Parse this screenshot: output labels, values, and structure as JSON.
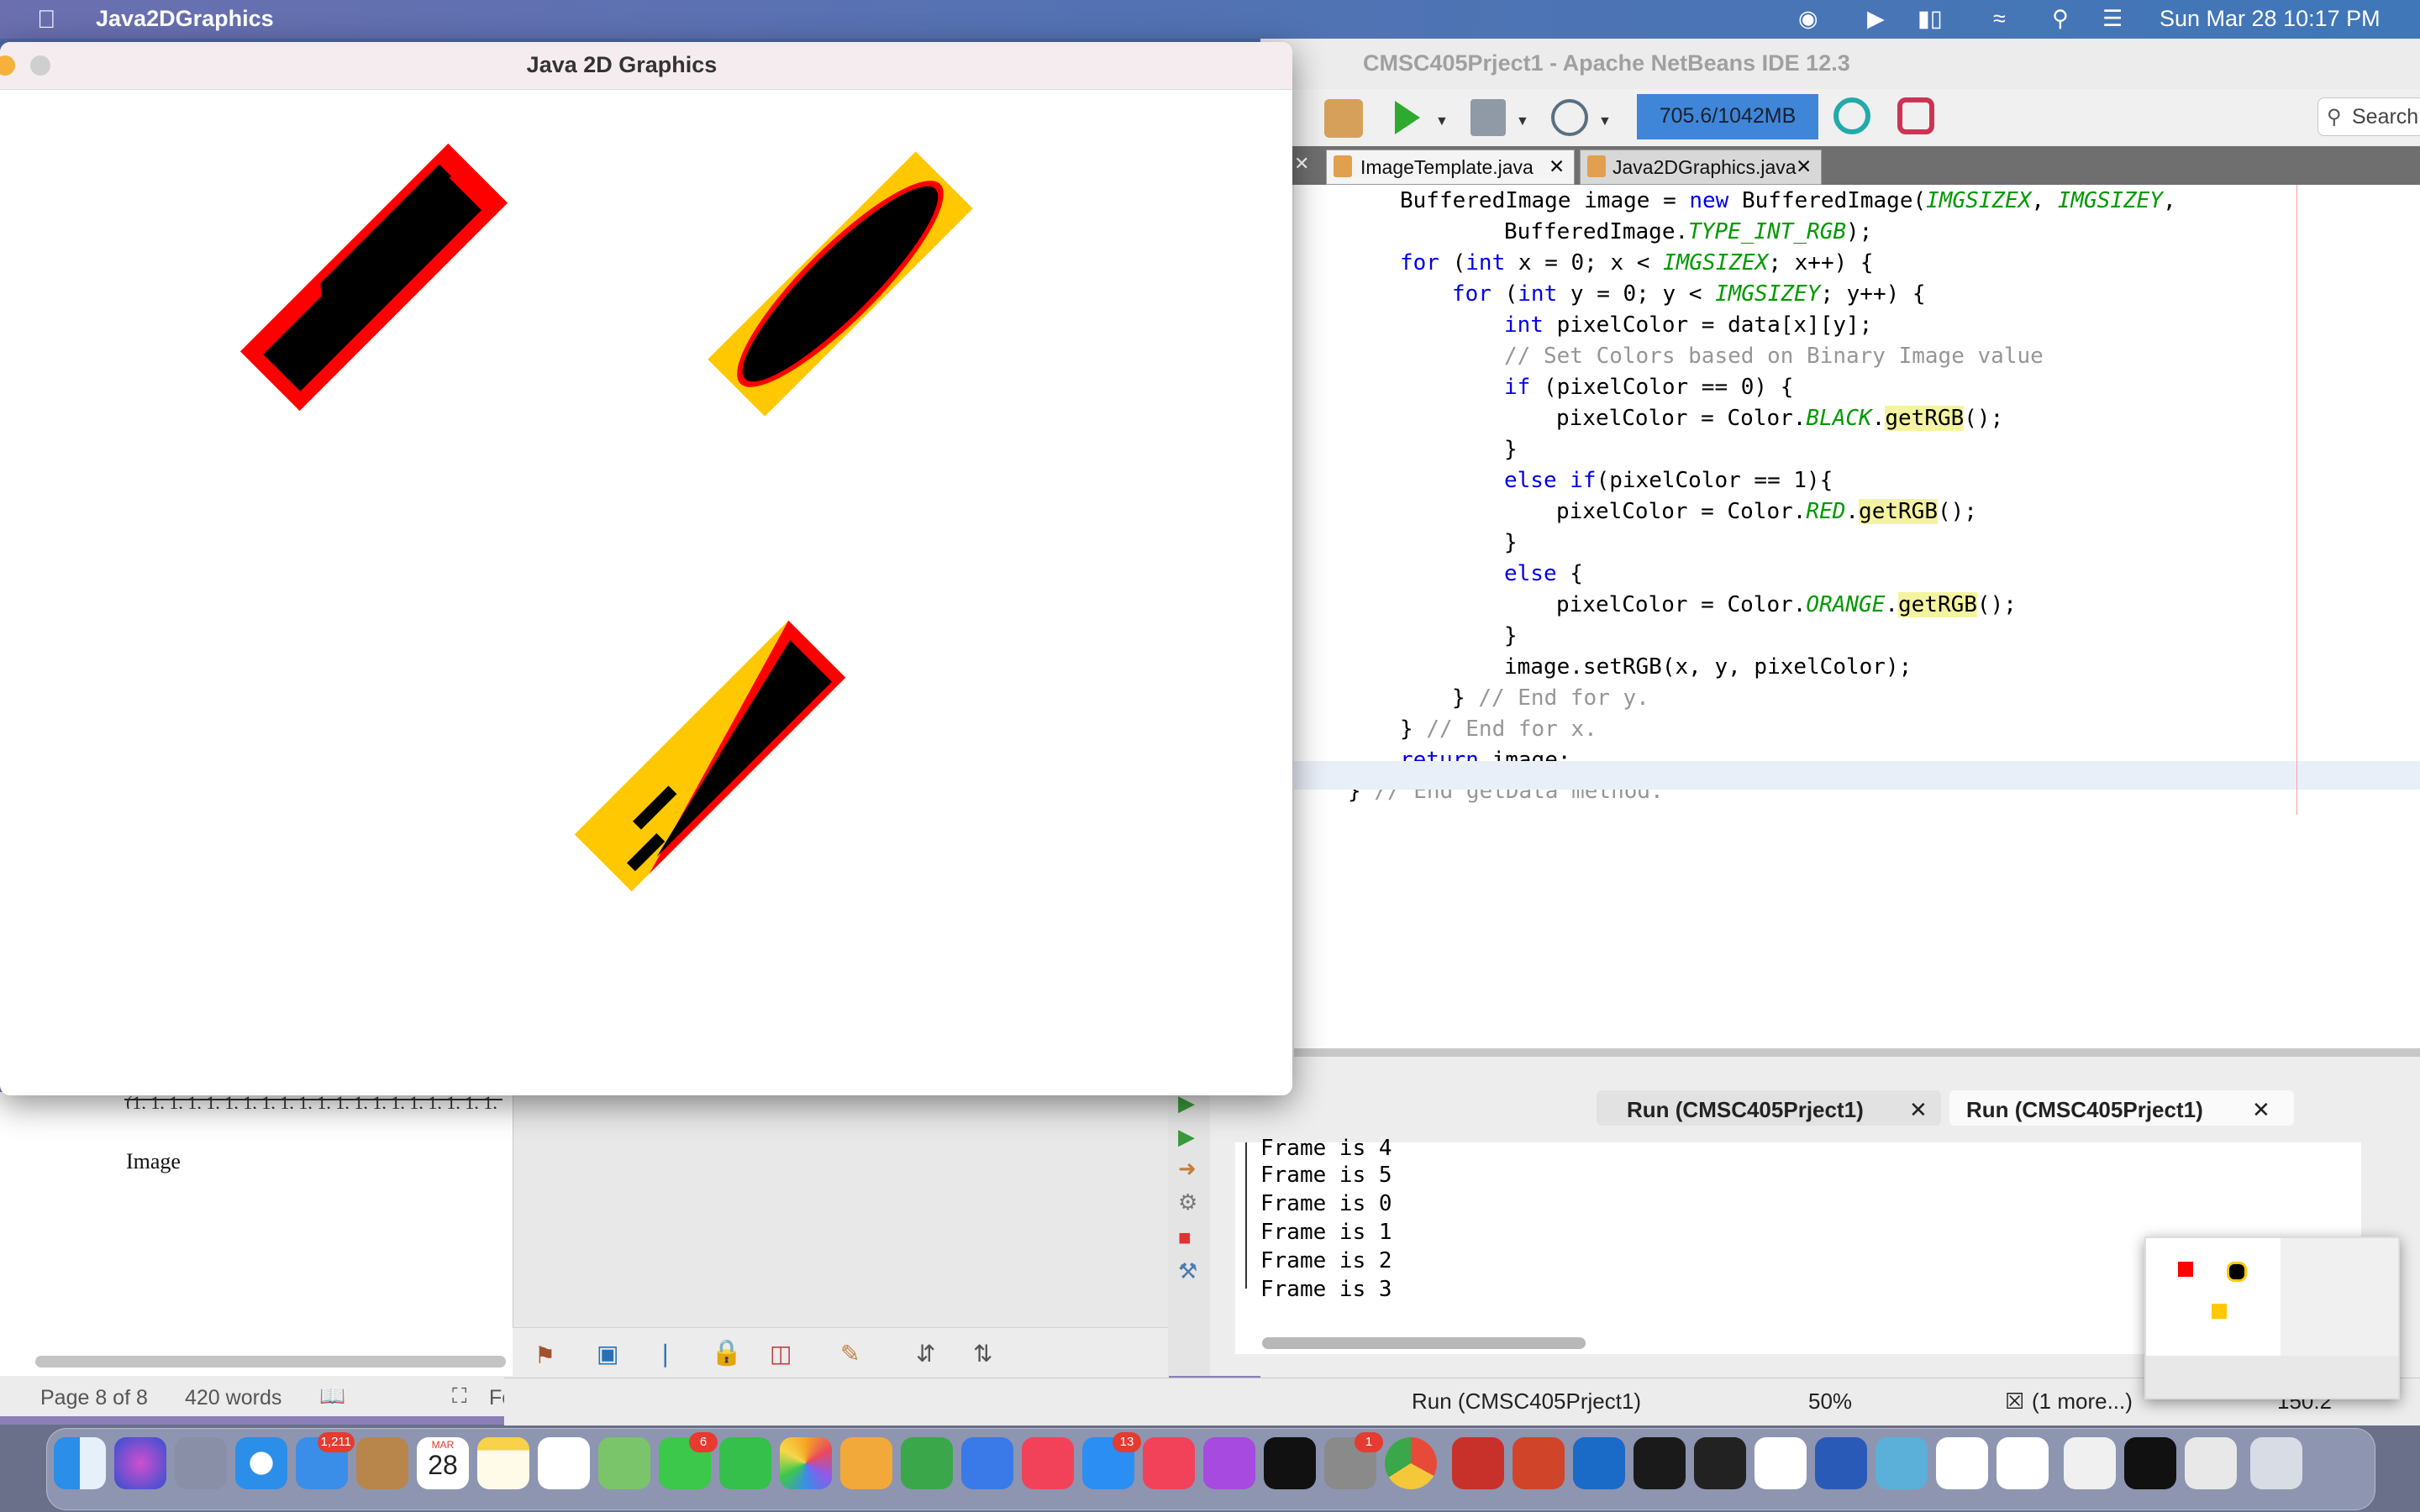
{
  "menubar": {
    "app_name": "Java2DGraphics",
    "datetime": "Sun Mar 28  10:17 PM"
  },
  "java_window": {
    "title": "Java 2D Graphics"
  },
  "netbeans": {
    "title": "CMSC405Prject1 - Apache NetBeans IDE 12.3",
    "memory": "705.6/1042MB",
    "search_placeholder": "Search",
    "tabs": [
      "ImageTemplate.java",
      "Java2DGraphics.java"
    ],
    "code": [
      {
        "indent": 1,
        "html": "BufferedImage image = <span class='kw'>new</span> BufferedImage(<span class='it'>IMGSIZEX</span>, <span class='it'>IMGSIZEY</span>,"
      },
      {
        "indent": 3,
        "html": "BufferedImage.<span class='it'>TYPE_INT_RGB</span>);"
      },
      {
        "indent": 1,
        "html": "<span class='kw'>for</span> (<span class='kw'>int</span> x = 0; x &lt; <span class='it'>IMGSIZEX</span>; x++) {"
      },
      {
        "indent": 2,
        "html": "<span class='kw'>for</span> (<span class='kw'>int</span> y = 0; y &lt; <span class='it'>IMGSIZEY</span>; y++) {"
      },
      {
        "indent": 3,
        "html": "<span class='kw'>int</span> pixelColor = data[x][y];"
      },
      {
        "indent": 3,
        "html": "<span class='cm'>// Set Colors based on Binary Image value</span>"
      },
      {
        "indent": 3,
        "html": "<span class='kw'>if</span> (pixelColor == 0) {"
      },
      {
        "indent": 4,
        "html": "pixelColor = Color.<span class='it'>BLACK</span>.<span class='hl'>getRGB</span>();"
      },
      {
        "indent": 3,
        "html": "}"
      },
      {
        "indent": 3,
        "html": "<span class='kw'>else if</span>(pixelColor == 1){"
      },
      {
        "indent": 4,
        "html": "pixelColor = Color.<span class='it'>RED</span>.<span class='hl'>getRGB</span>();"
      },
      {
        "indent": 3,
        "html": "}"
      },
      {
        "indent": 3,
        "html": "<span class='kw'>else</span> {"
      },
      {
        "indent": 4,
        "html": "pixelColor = Color.<span class='it'>ORANGE</span>.<span class='hl'>getRGB</span>();"
      },
      {
        "indent": 3,
        "html": "}"
      },
      {
        "indent": 3,
        "html": "image.setRGB(x, y, pixelColor);"
      },
      {
        "indent": 2,
        "html": "} <span class='cm'>// End for y.</span>"
      },
      {
        "indent": 1,
        "html": "} <span class='cm'>// End for x.</span>"
      },
      {
        "indent": 1,
        "html": "<span class='kw'>return</span> image;"
      },
      {
        "indent": 0,
        "html": "} <span class='cm'>// End getData method.</span>"
      }
    ],
    "output_tabs": [
      "Run (CMSC405Prject1)",
      "Run (CMSC405Prject1)"
    ],
    "output_lines": [
      "Frame is 4",
      "Frame is 5",
      "Frame is 0",
      "Frame is 1",
      "Frame is 2",
      "Frame is 3"
    ],
    "status_run": "Run (CMSC405Prject1)",
    "status_progress": "50%",
    "status_more": "(1 more...)",
    "status_pos": "150:2"
  },
  "doc": {
    "dots": "(1, 1, 1, 1, 1, 1, 1, 1, 1, 1, 1, 1, 1, 1, 1, 1, 1, 1, 1, 1,",
    "image_label": "Image",
    "page": "Page 8 of 8",
    "words": "420 words",
    "focus": "Fc"
  },
  "dock": {
    "mail_badge": "1,211",
    "messages_badge": "6",
    "appstore_badge": "13",
    "settings_badge": "1",
    "calendar_month": "MAR",
    "calendar_day": "28"
  },
  "colors": {
    "red": "#ff0000",
    "orange": "#ffc800",
    "black": "#000000",
    "memory_bar": "#3f86d8"
  }
}
